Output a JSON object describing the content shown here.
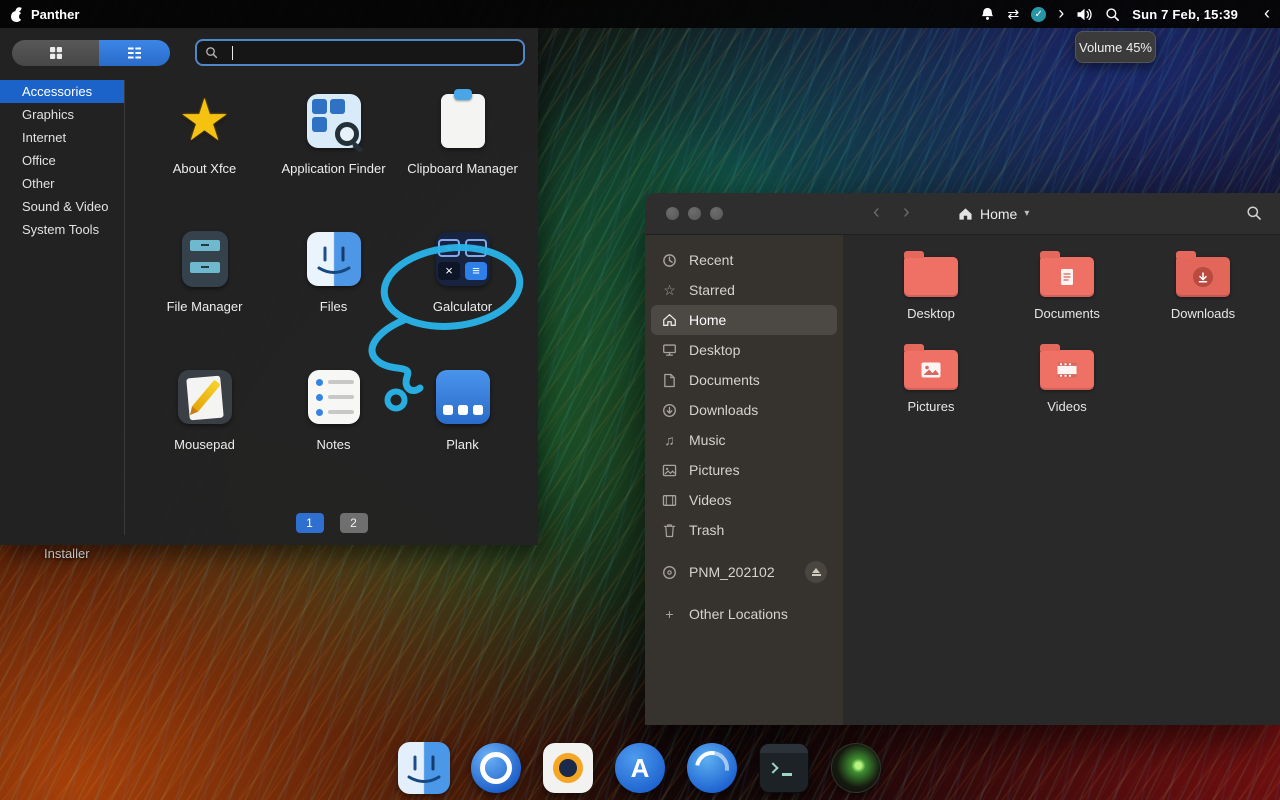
{
  "topbar": {
    "os_name": "Panther",
    "clock": "Sun 7 Feb, 15:39"
  },
  "volume_popup": {
    "label": "Volume 45%"
  },
  "launcher": {
    "search": {
      "value": "",
      "placeholder": ""
    },
    "categories": [
      {
        "label": "Accessories"
      },
      {
        "label": "Graphics"
      },
      {
        "label": "Internet"
      },
      {
        "label": "Office"
      },
      {
        "label": "Other"
      },
      {
        "label": "Sound & Video"
      },
      {
        "label": "System Tools"
      }
    ],
    "apps": [
      {
        "label": "About Xfce",
        "icon": "star-icon"
      },
      {
        "label": "Application Finder",
        "icon": "app-finder-icon"
      },
      {
        "label": "Clipboard Manager",
        "icon": "clipboard-icon"
      },
      {
        "label": "File Manager",
        "icon": "file-cabinet-icon"
      },
      {
        "label": "Files",
        "icon": "finder-face-icon"
      },
      {
        "label": "Galculator",
        "icon": "calculator-icon"
      },
      {
        "label": "Mousepad",
        "icon": "notepad-pencil-icon"
      },
      {
        "label": "Notes",
        "icon": "notes-list-icon"
      },
      {
        "label": "Plank",
        "icon": "plank-dock-icon"
      }
    ],
    "calc": {
      "plus": "+",
      "minus": "−",
      "times": "×",
      "menu": "≡"
    },
    "pages": [
      {
        "label": "1"
      },
      {
        "label": "2"
      }
    ]
  },
  "desktop": {
    "installer_label": "Installer"
  },
  "files": {
    "location": "Home",
    "sidebar": [
      {
        "label": "Recent"
      },
      {
        "label": "Starred"
      },
      {
        "label": "Home"
      },
      {
        "label": "Desktop"
      },
      {
        "label": "Documents"
      },
      {
        "label": "Downloads"
      },
      {
        "label": "Music"
      },
      {
        "label": "Pictures"
      },
      {
        "label": "Videos"
      },
      {
        "label": "Trash"
      },
      {
        "label": "PNM_202102"
      },
      {
        "label": "Other Locations"
      }
    ],
    "folders": [
      {
        "label": "Desktop"
      },
      {
        "label": "Documents"
      },
      {
        "label": "Downloads"
      },
      {
        "label": "Pictures"
      },
      {
        "label": "Videos"
      }
    ]
  },
  "dock": {
    "app_store_letter": "A",
    "items": [
      {
        "icon": "files-icon"
      },
      {
        "icon": "web-browser-icon"
      },
      {
        "icon": "camera-icon"
      },
      {
        "icon": "app-store-icon"
      },
      {
        "icon": "browser-icon"
      },
      {
        "icon": "terminal-icon"
      },
      {
        "icon": "screen-recorder-icon"
      }
    ]
  },
  "colors": {
    "accent": "#3584e4",
    "folder": "#ef7166",
    "annotation": "#2ab4ea"
  }
}
